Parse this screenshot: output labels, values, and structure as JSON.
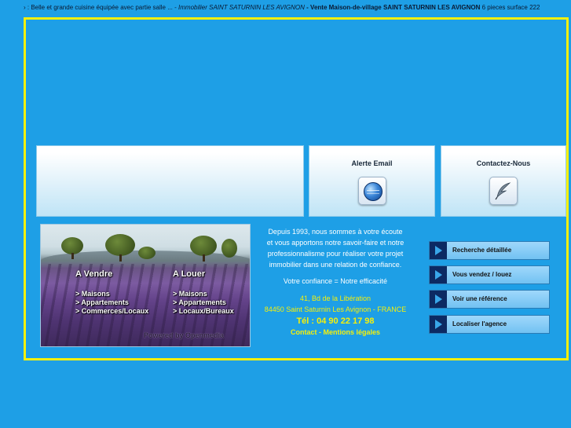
{
  "ticker": {
    "part1": "› : Belle et grande cuisine équipée avec partie salle ... -",
    "part2": "Immobilier SAINT SATURNIN LES AVIGNON",
    "part3": "- Vente Maison-de-village SAINT SATURNIN LES AVIGNON",
    "part4": "6 pieces surface 222"
  },
  "panels": {
    "alert_title": "Alerte Email",
    "contact_title": "Contactez-Nous",
    "alert_icon": "globe-icon",
    "contact_icon": "feather-pen-icon"
  },
  "photo": {
    "col1_title": "A Vendre",
    "col1_items": [
      "> Maisons",
      "> Appartements",
      "> Commerces/Locaux"
    ],
    "col2_title": "A Louer",
    "col2_items": [
      "> Maisons",
      "> Appartements",
      "> Locaux/Bureaux"
    ],
    "powered": "Powered by Openmedia"
  },
  "center": {
    "lines": [
      "Depuis 1993, nous sommes à votre écoute",
      "et vous apportons notre savoir-faire et notre",
      "professionnalisme pour réaliser votre projet",
      "immobilier dans une relation de confiance."
    ],
    "slogan": "Votre confiance = Notre efficacité",
    "address1": "41, Bd de la Libération",
    "address2": "84450 Saint Saturnin Les Avignon - FRANCE",
    "phone": "Tél : 04 90 22 17 98",
    "contact_link": "Contact",
    "separator": " - ",
    "legal_link": "Mentions légales"
  },
  "side_buttons": [
    "Recherche détaillée",
    "Vous vendez / louez",
    "Voir une référence",
    "Localiser l'agence"
  ],
  "colors": {
    "background": "#1e9fe6",
    "accent_yellow": "#f6f00a",
    "button_dark": "#0c2a63"
  }
}
